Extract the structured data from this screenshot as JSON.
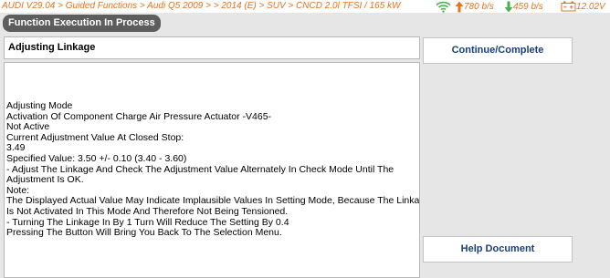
{
  "topbar": {
    "breadcrumb": "AUDI V29.04 > Guided Functions > Audi Q5 2009 > > 2014 (E) > SUV > CNCD 2.0l TFSI / 165 kW",
    "upload_speed": "780 b/s",
    "download_speed": "459 b/s",
    "battery_voltage": "12.02V",
    "accent_color": "#e8731c",
    "icons": [
      "wifi-icon",
      "arrow-up-icon",
      "arrow-down-icon",
      "battery-icon"
    ]
  },
  "header": {
    "pill_label": "Function Execution In Process"
  },
  "panel": {
    "title": "Adjusting Linkage",
    "lines": [
      "Adjusting Mode",
      "Activation Of Component Charge Air Pressure Actuator -V465-",
      "Not Active",
      "Current Adjustment Value At Closed Stop:",
      "3.49",
      "Specified Value: 3.50 +/- 0.10 (3.40 - 3.60)",
      "- Adjust The Linkage And Check The Adjustment Value Alternately In Check Mode Until The",
      "Adjustment Is OK.",
      " Note:",
      "The Displayed Actual Value May Indicate Implausible Values In Setting Mode, Because The Linkage",
      "Is Not Activated In This Mode And Therefore Not Being Tensioned.",
      "- Turning The Linkage In By 1 Turn Will Reduce The Setting By 0.4",
      "Pressing The  Button Will Bring You Back To The Selection Menu."
    ]
  },
  "buttons": {
    "continue_label": "Continue/Complete",
    "help_label": "Help Document"
  }
}
